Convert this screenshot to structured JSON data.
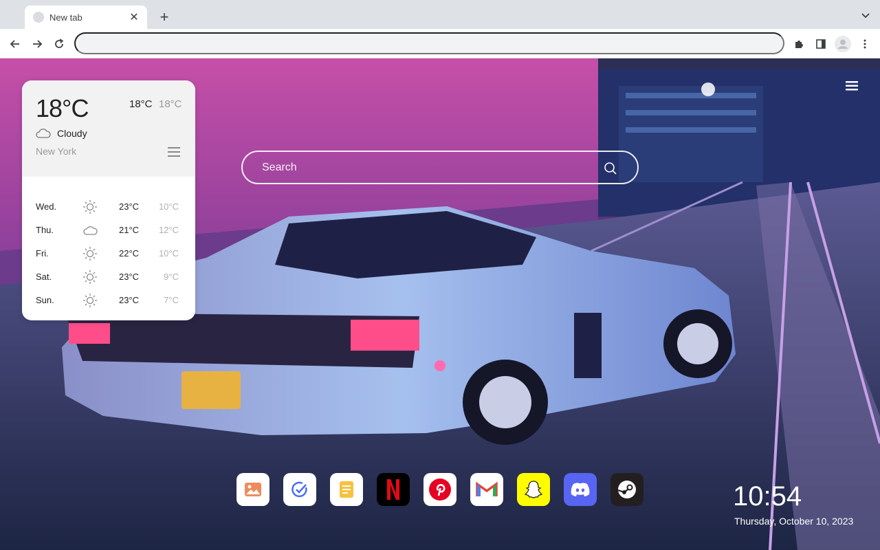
{
  "browser": {
    "tab_title": "New tab",
    "close_symbol": "✕",
    "new_tab_symbol": "+",
    "address_value": ""
  },
  "search": {
    "placeholder": "Search"
  },
  "weather": {
    "current_temp": "18°C",
    "high": "18°C",
    "low": "18°C",
    "condition": "Cloudy",
    "condition_icon": "cloud-icon",
    "city": "New York",
    "forecast": [
      {
        "day": "Wed.",
        "icon": "sun-icon",
        "high": "23°C",
        "low": "10°C"
      },
      {
        "day": "Thu.",
        "icon": "cloud-icon",
        "high": "21°C",
        "low": "12°C"
      },
      {
        "day": "Fri.",
        "icon": "sun-icon",
        "high": "22°C",
        "low": "10°C"
      },
      {
        "day": "Sat.",
        "icon": "sun-icon",
        "high": "23°C",
        "low": "9°C"
      },
      {
        "day": "Sun.",
        "icon": "sun-icon",
        "high": "23°C",
        "low": "7°C"
      }
    ]
  },
  "dock": {
    "apps": [
      "gallery",
      "tasks",
      "notes",
      "netflix",
      "pinterest",
      "gmail",
      "snapchat",
      "discord",
      "steam"
    ]
  },
  "clock": {
    "time": "10:54",
    "date": "Thursday, October 10, 2023"
  }
}
